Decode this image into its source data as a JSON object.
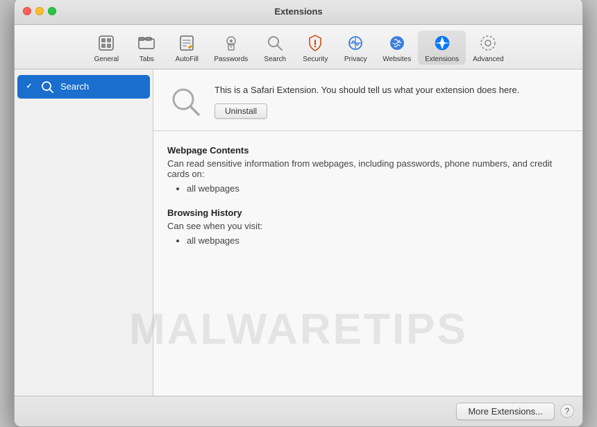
{
  "window": {
    "title": "Extensions"
  },
  "toolbar": {
    "items": [
      {
        "id": "general",
        "label": "General",
        "icon": "general"
      },
      {
        "id": "tabs",
        "label": "Tabs",
        "icon": "tabs"
      },
      {
        "id": "autofill",
        "label": "AutoFill",
        "icon": "autofill"
      },
      {
        "id": "passwords",
        "label": "Passwords",
        "icon": "passwords"
      },
      {
        "id": "search",
        "label": "Search",
        "icon": "search"
      },
      {
        "id": "security",
        "label": "Security",
        "icon": "security"
      },
      {
        "id": "privacy",
        "label": "Privacy",
        "icon": "privacy"
      },
      {
        "id": "websites",
        "label": "Websites",
        "icon": "websites"
      },
      {
        "id": "extensions",
        "label": "Extensions",
        "icon": "extensions",
        "active": true
      },
      {
        "id": "advanced",
        "label": "Advanced",
        "icon": "advanced"
      }
    ]
  },
  "sidebar": {
    "items": [
      {
        "id": "search-ext",
        "label": "Search",
        "checked": true,
        "selected": true
      }
    ]
  },
  "extension": {
    "description": "This is a Safari Extension. You should tell us what your extension does here.",
    "uninstall_label": "Uninstall",
    "permissions": [
      {
        "title": "Webpage Contents",
        "description": "Can read sensitive information from webpages, including passwords, phone numbers, and credit cards on:",
        "items": [
          "all webpages"
        ]
      },
      {
        "title": "Browsing History",
        "description": "Can see when you visit:",
        "items": [
          "all webpages"
        ]
      }
    ]
  },
  "footer": {
    "more_extensions_label": "More Extensions...",
    "help_label": "?"
  },
  "watermark": {
    "text": "MALWARETIPS"
  }
}
